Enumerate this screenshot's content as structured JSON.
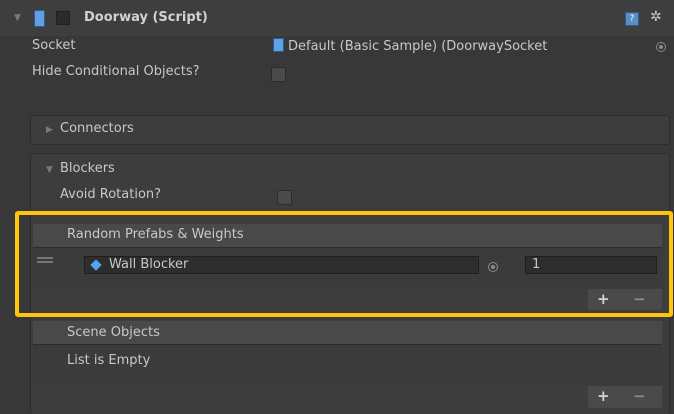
{
  "component": {
    "title": "Doorway (Script)",
    "enabled": true
  },
  "fields": {
    "socket_label": "Socket",
    "socket_value": "Default (Basic Sample) (DoorwaySocket",
    "hide_conditional_label": "Hide Conditional Objects?",
    "hide_conditional_checked": false
  },
  "connectors": {
    "label": "Connectors",
    "expanded": false
  },
  "blockers": {
    "label": "Blockers",
    "expanded": true,
    "avoid_rotation_label": "Avoid Rotation?",
    "avoid_rotation_checked": false,
    "random_prefabs": {
      "header": "Random Prefabs & Weights",
      "items": [
        {
          "object": "Wall Blocker",
          "weight": "1"
        }
      ],
      "add": "+",
      "remove": "−"
    },
    "scene_objects": {
      "header": "Scene Objects",
      "empty_text": "List is Empty",
      "add": "+",
      "remove": "−"
    }
  },
  "colors": {
    "highlight": "#ffc40c",
    "background": "#383838"
  }
}
